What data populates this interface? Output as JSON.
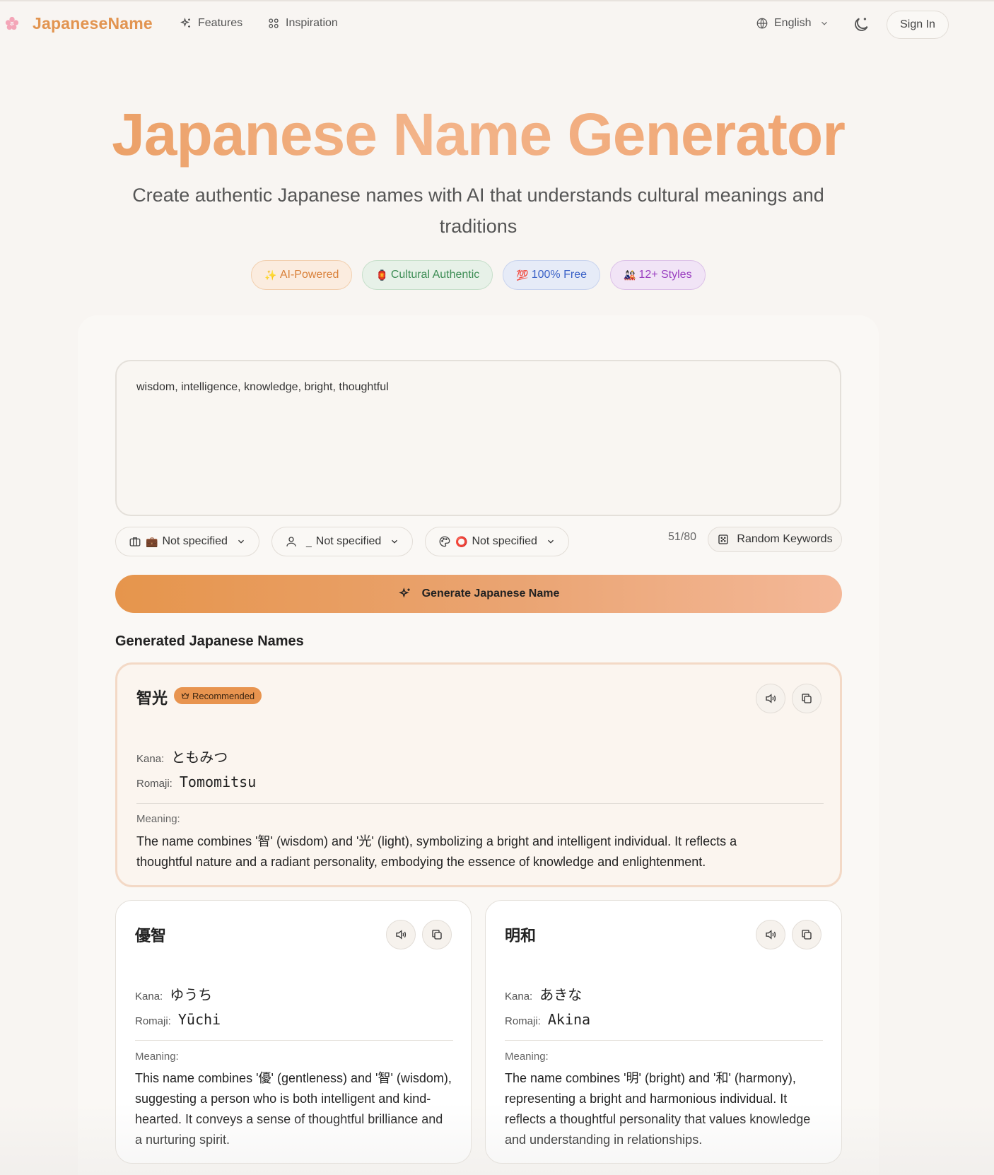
{
  "header": {
    "logo": "JapaneseName",
    "nav": [
      {
        "label": "Features",
        "icon": "sparkles-icon"
      },
      {
        "label": "Inspiration",
        "icon": "grid-icon"
      }
    ],
    "language": "English",
    "sign_in": "Sign In"
  },
  "hero": {
    "title": "Japanese Name Generator",
    "subtitle": "Create authentic Japanese names with AI that understands cultural meanings and traditions",
    "badges": [
      {
        "emoji": "✨",
        "label": "AI-Powered",
        "color": "#d9813a"
      },
      {
        "emoji": "🏮",
        "label": "Cultural Authentic",
        "color": "#3d8d55"
      },
      {
        "emoji": "💯",
        "label": "100% Free",
        "color": "#3b62c7"
      },
      {
        "emoji": "🎎",
        "label": "12+ Styles",
        "color": "#9a3fc0"
      }
    ]
  },
  "form": {
    "keywords_value": "wisdom, intelligence, knowledge, bright, thoughtful",
    "selects": [
      {
        "emoji": "💼",
        "label": "Not specified",
        "icon": "briefcase-icon"
      },
      {
        "emoji": "_",
        "label": "Not specified",
        "icon": "user-icon"
      },
      {
        "emoji": "⭕",
        "label": "Not specified",
        "icon": "palette-icon"
      }
    ],
    "counter": "51/80",
    "random_keywords": "Random Keywords",
    "generate": "Generate Japanese Name"
  },
  "results": {
    "title": "Generated Japanese Names",
    "kana_label": "Kana:",
    "romaji_label": "Romaji:",
    "meaning_label": "Meaning:",
    "recommended": "Recommended",
    "names": [
      {
        "kanji": "智光",
        "kana": "ともみつ",
        "romaji": "Tomomitsu",
        "meaning": "The name combines '智' (wisdom) and '光' (light), symbolizing a bright and intelligent individual. It reflects a thoughtful nature and a radiant personality, embodying the essence of knowledge and enlightenment."
      },
      {
        "kanji": "優智",
        "kana": "ゆうち",
        "romaji": "Yūchi",
        "meaning": "This name combines '優' (gentleness) and '智' (wisdom), suggesting a person who is both intelligent and kind-hearted. It conveys a sense of thoughtful brilliance and a nurturing spirit."
      },
      {
        "kanji": "明和",
        "kana": "あきな",
        "romaji": "Akina",
        "meaning": "The name combines '明' (bright) and '和' (harmony), representing a bright and harmonious individual. It reflects a thoughtful personality that values knowledge and understanding in relationships."
      }
    ]
  },
  "colors": {
    "accent": "#e29450",
    "background": "#f8f5f2"
  }
}
